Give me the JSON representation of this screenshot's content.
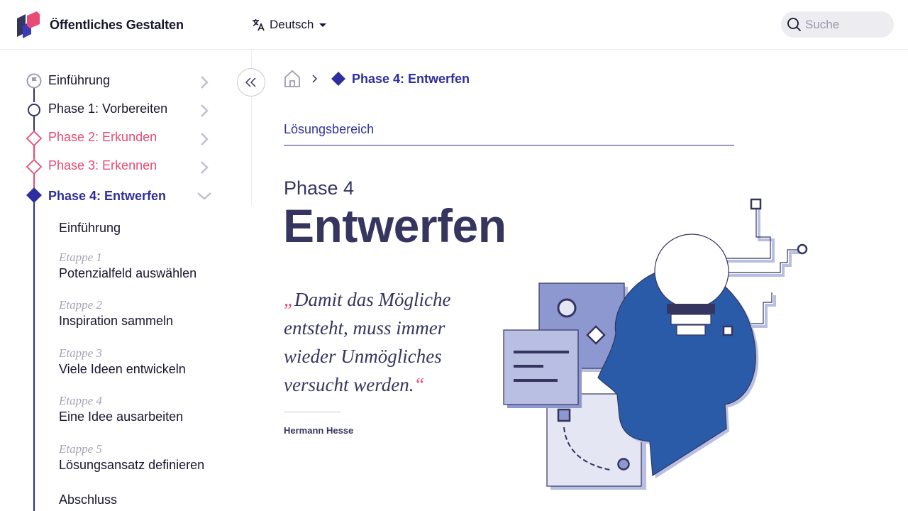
{
  "header": {
    "brand": "Öffentliches Gestalten",
    "language": "Deutsch",
    "search_placeholder": "Suche"
  },
  "sidebar": {
    "items": [
      {
        "label": "Einführung",
        "state": "intro"
      },
      {
        "label": "Phase 1: Vorbereiten",
        "state": "default"
      },
      {
        "label": "Phase 2: Erkunden",
        "state": "pink"
      },
      {
        "label": "Phase 3: Erkennen",
        "state": "pink"
      },
      {
        "label": "Phase 4: Entwerfen",
        "state": "active"
      }
    ],
    "subitems": [
      {
        "stage": "",
        "title": "Einführung"
      },
      {
        "stage": "Etappe 1",
        "title": "Potenzialfeld auswählen"
      },
      {
        "stage": "Etappe 2",
        "title": "Inspiration sammeln"
      },
      {
        "stage": "Etappe 3",
        "title": "Viele Ideen entwickeln"
      },
      {
        "stage": "Etappe 4",
        "title": "Eine Idee ausarbeiten"
      },
      {
        "stage": "Etappe 5",
        "title": "Lösungsansatz definieren"
      },
      {
        "stage": "",
        "title": "Abschluss"
      }
    ]
  },
  "breadcrumb": {
    "current": "Phase 4: Entwerfen"
  },
  "main": {
    "section": "Lösungsbereich",
    "phase_label": "Phase 4",
    "title": "Entwerfen",
    "quote_open": "„",
    "quote_text": "Damit das Mögliche entsteht, muss immer wieder Unmögliches versucht werden.",
    "quote_close": "“",
    "author": "Hermann Hesse"
  },
  "colors": {
    "navy": "#35355f",
    "indigo": "#2e2e9e",
    "pink": "#e84b73",
    "blue": "#2a5ba8",
    "lavender": "#8e98d0",
    "light_lavender": "#b8bfe3",
    "pale": "#e4e6f4"
  }
}
